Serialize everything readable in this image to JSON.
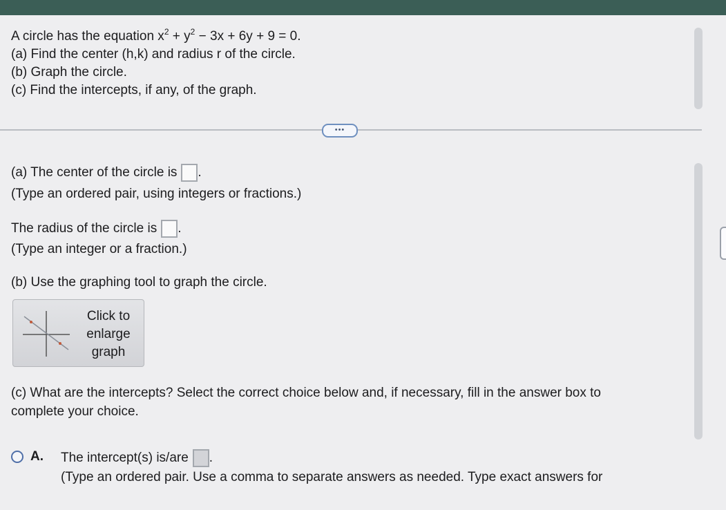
{
  "problem": {
    "intro": "A circle has the equation x",
    "eq_parts": [
      "+ y",
      "− 3x + 6y + 9 = 0."
    ],
    "exponent": "2",
    "part_a": "(a) Find the center (h,k) and radius r of the circle.",
    "part_b": "(b) Graph the circle.",
    "part_c": "(c) Find the intercepts, if any, of the graph."
  },
  "more_button": "•••",
  "answers": {
    "center_label": "(a) The center of the circle is",
    "center_hint": "(Type an ordered pair, using integers or fractions.)",
    "center_value": "",
    "radius_label": "The radius of the circle is",
    "radius_hint": "(Type an integer or a fraction.)",
    "radius_value": "",
    "period": "."
  },
  "graph": {
    "instruction": "(b) Use the graphing tool to graph the circle.",
    "button_lines": [
      "Click to",
      "enlarge",
      "graph"
    ]
  },
  "intercepts": {
    "question_line1": "(c) What are the intercepts? Select the correct choice below and, if necessary, fill in the answer box to",
    "question_line2": "complete your choice.",
    "option_a_letter": "A.",
    "option_a_text": "The intercept(s) is/are",
    "option_a_value": "",
    "option_a_hint": "(Type an ordered pair. Use a comma to separate answers as needed. Type exact answers for"
  },
  "side_tab_icon": "⋮"
}
